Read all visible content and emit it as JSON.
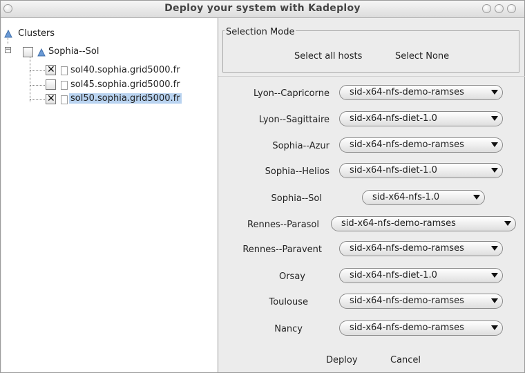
{
  "window": {
    "title": "Deploy your system with Kadeploy"
  },
  "tree": {
    "root_label": "Clusters",
    "cluster": {
      "label": "Sophia--Sol",
      "checked": false
    },
    "hosts": [
      {
        "label": "sol40.sophia.grid5000.fr",
        "checked": true,
        "selected": false
      },
      {
        "label": "sol45.sophia.grid5000.fr",
        "checked": false,
        "selected": false
      },
      {
        "label": "sol50.sophia.grid5000.fr",
        "checked": true,
        "selected": true
      }
    ]
  },
  "selection_mode": {
    "title": "Selection Mode",
    "select_all": "Select all hosts",
    "select_none": "Select None"
  },
  "clusters": [
    {
      "name": "Lyon--Capricorne",
      "image": "sid-x64-nfs-demo-ramses"
    },
    {
      "name": "Lyon--Sagittaire",
      "image": "sid-x64-nfs-diet-1.0"
    },
    {
      "name": "Sophia--Azur",
      "image": "sid-x64-nfs-demo-ramses"
    },
    {
      "name": "Sophia--Helios",
      "image": "sid-x64-nfs-diet-1.0"
    },
    {
      "name": "Sophia--Sol",
      "image": "sid-x64-nfs-1.0"
    },
    {
      "name": "Rennes--Parasol",
      "image": "sid-x64-nfs-demo-ramses"
    },
    {
      "name": "Rennes--Paravent",
      "image": "sid-x64-nfs-demo-ramses"
    },
    {
      "name": "Orsay",
      "image": "sid-x64-nfs-diet-1.0"
    },
    {
      "name": "Toulouse",
      "image": "sid-x64-nfs-demo-ramses"
    },
    {
      "name": "Nancy",
      "image": "sid-x64-nfs-demo-ramses"
    }
  ],
  "actions": {
    "deploy": "Deploy",
    "cancel": "Cancel"
  },
  "colors": {
    "selection": "#b9d3f0",
    "window_bg": "#ececec"
  }
}
